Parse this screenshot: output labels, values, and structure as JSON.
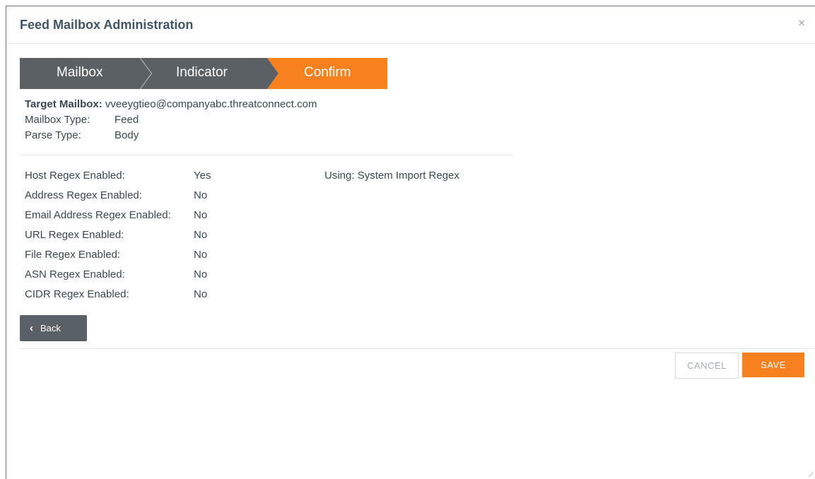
{
  "dialog": {
    "title": "Feed Mailbox Administration",
    "close_icon": "close-icon",
    "close_glyph": "×"
  },
  "wizard": {
    "steps": [
      {
        "label": "Mailbox",
        "state": "done"
      },
      {
        "label": "Indicator",
        "state": "done"
      },
      {
        "label": "Confirm",
        "state": "active"
      }
    ],
    "colors": {
      "inactive": "#5b6065",
      "active": "#f7801f"
    }
  },
  "summary": {
    "target_label": "Target Mailbox:",
    "target_value": "vveeygtieo@companyabc.threatconnect.com",
    "mailbox_type_label": "Mailbox Type:",
    "mailbox_type_value": "Feed",
    "parse_type_label": "Parse Type:",
    "parse_type_value": "Body"
  },
  "regex": {
    "using_text": "Using: System Import Regex",
    "rows": [
      {
        "label": "Host Regex Enabled:",
        "value": "Yes"
      },
      {
        "label": "Address Regex Enabled:",
        "value": "No"
      },
      {
        "label": "Email Address Regex Enabled:",
        "value": "No"
      },
      {
        "label": "URL Regex Enabled:",
        "value": "No"
      },
      {
        "label": "File Regex Enabled:",
        "value": "No"
      },
      {
        "label": "ASN Regex Enabled:",
        "value": "No"
      },
      {
        "label": "CIDR Regex Enabled:",
        "value": "No"
      }
    ]
  },
  "buttons": {
    "back_label": "Back",
    "back_icon": "chevron-left-icon",
    "back_glyph": "‹",
    "cancel_label": "CANCEL",
    "save_label": "SAVE"
  },
  "colors": {
    "accent": "#f7801f",
    "title": "#415564",
    "text": "#3c4650",
    "button_dark": "#5a6166"
  }
}
